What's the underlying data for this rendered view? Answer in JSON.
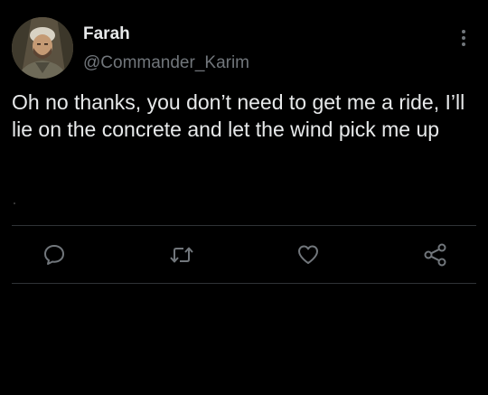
{
  "tweet": {
    "author": {
      "display_name": "Farah",
      "handle": "@Commander_Karim",
      "avatar_icon": "user-avatar"
    },
    "text": "Oh no thanks, you don’t need to get me a ride, I’ll lie on the concrete and let the wind pick me up",
    "menu_icon": "more-vertical-icon"
  },
  "actions": [
    {
      "name": "reply",
      "icon": "reply-icon"
    },
    {
      "name": "retweet",
      "icon": "retweet-icon"
    },
    {
      "name": "like",
      "icon": "heart-icon"
    },
    {
      "name": "share",
      "icon": "share-icon"
    }
  ],
  "colors": {
    "background": "#000000",
    "primary_text": "#e7e9ea",
    "secondary_text": "#71767b",
    "divider": "#2f3336"
  }
}
